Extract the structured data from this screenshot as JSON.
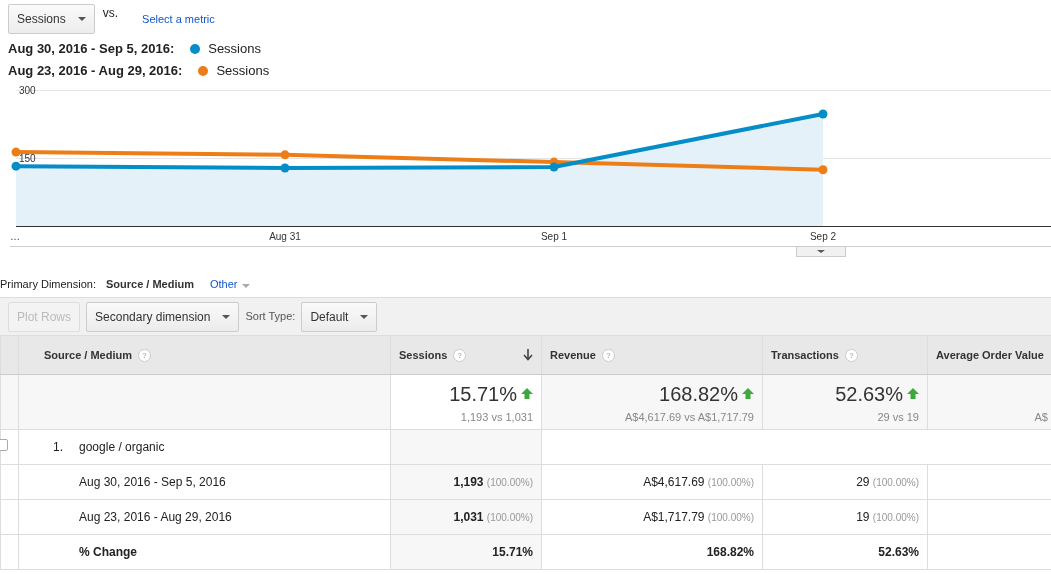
{
  "metric_picker": {
    "value": "Sessions",
    "vs_label": "vs.",
    "link": "Select a metric"
  },
  "legend": [
    {
      "separator": ":",
      "metric": "Sessions"
    },
    {
      "separator": ":",
      "metric": "Sessions"
    }
  ],
  "chart_data": {
    "type": "area",
    "categories": [
      "…",
      "Aug 31",
      "Sep 1",
      "Sep 2"
    ],
    "yticks": [
      150,
      300
    ],
    "ylim": [
      0,
      300
    ],
    "series": [
      {
        "name": "Aug 30, 2016 - Sep 5, 2016",
        "color": "#058dc7",
        "type": "area",
        "marker": true,
        "values": [
          132,
          128,
          130,
          247
        ]
      },
      {
        "name": "Aug 23, 2016 - Aug 29, 2016",
        "color": "#ed7e17",
        "type": "line",
        "marker": true,
        "values": [
          163,
          157,
          141,
          124
        ]
      }
    ]
  },
  "primary_dimension": {
    "label": "Primary Dimension:",
    "options": [
      {
        "label": "Source / Medium",
        "selected": true
      },
      {
        "label": "Other",
        "selected": false
      }
    ]
  },
  "toolbar": {
    "plot_rows": {
      "label": "Plot Rows",
      "disabled": true
    },
    "secondary": "Secondary dimension",
    "sort_label": "Sort Type:",
    "sort_value": "Default"
  },
  "table": {
    "columns": [
      {
        "label": "Source / Medium",
        "help": "?",
        "sorted": false
      },
      {
        "label": "Sessions",
        "help": "?",
        "sorted": true
      },
      {
        "label": "Revenue",
        "help": "?",
        "sorted": false
      },
      {
        "label": "Transactions",
        "help": "?",
        "sorted": false
      },
      {
        "label": "Average Order Value",
        "sorted": false
      }
    ],
    "summary": [
      {
        "value": "15.71%",
        "detail": "1,193 vs 1,031"
      },
      {
        "value": "168.82%",
        "detail": "A$4,617.69 vs A$1,717.79"
      },
      {
        "value": "52.63%",
        "detail": "29 vs 19"
      },
      {
        "detail": "A$"
      }
    ],
    "group": {
      "index": "1.",
      "label": "google / organic",
      "checked": false
    },
    "rows": [
      {
        "kind": "range",
        "cells": [
          {
            "value": "Aug 30, 2016 - Sep 5, 2016"
          },
          {
            "value": "1,193",
            "share": "(100.00%)"
          },
          {
            "value": "A$4,617.69",
            "share": "(100.00%)"
          },
          {
            "value": "29",
            "share": "(100.00%)"
          }
        ]
      },
      {
        "kind": "range",
        "cells": [
          {
            "value": "Aug 23, 2016 - Aug 29, 2016"
          },
          {
            "value": "1,031",
            "share": "(100.00%)"
          },
          {
            "value": "A$1,717.79",
            "share": "(100.00%)"
          },
          {
            "value": "19",
            "share": "(100.00%)"
          }
        ]
      },
      {
        "kind": "change",
        "cells": [
          {
            "value": "% Change"
          },
          {
            "value": "15.71%"
          },
          {
            "value": "168.82%"
          },
          {
            "value": "52.63%"
          }
        ]
      }
    ]
  }
}
